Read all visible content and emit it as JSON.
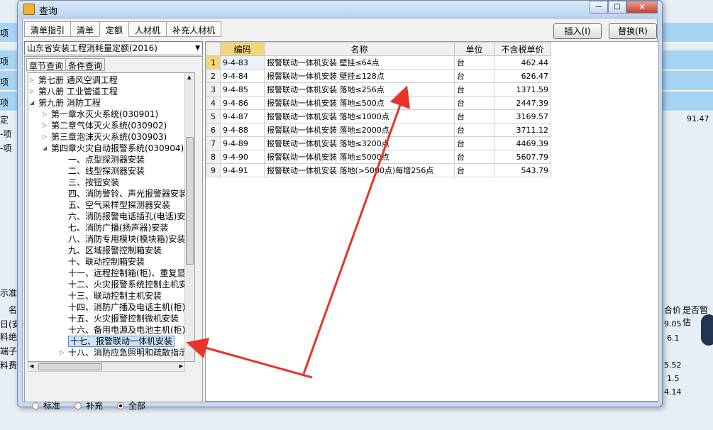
{
  "background": {
    "left_texts": [
      "项",
      "项",
      "项",
      "项",
      "定",
      "-项",
      "-项"
    ],
    "right_value": "91.47",
    "bottom_left": [
      "示准描",
      "名",
      "日(安",
      "料绝",
      "端子",
      "料费"
    ],
    "bottom_right_header": [
      "合价",
      "是否暂估"
    ],
    "bottom_right_values": [
      "9.05",
      "6.1",
      "5.52",
      "1.5",
      "4.14"
    ]
  },
  "dialog": {
    "title": "查询",
    "tabs": [
      "清单指引",
      "清单",
      "定额",
      "人材机",
      "补充人材机"
    ],
    "active_tab": 2,
    "insert_button": "插入(I)",
    "replace_button": "替换(R)",
    "library_select": "山东省安装工程消耗量定额(2016)",
    "subtabs": [
      "章节查询",
      "条件查询"
    ],
    "tree": [
      {
        "label": "第七册 通风空调工程",
        "level": 0,
        "exp": "right"
      },
      {
        "label": "第八册 工业管道工程",
        "level": 0,
        "exp": "right"
      },
      {
        "label": "第九册 消防工程",
        "level": 0,
        "exp": "down"
      },
      {
        "label": "第一章水灭火系统(030901)",
        "level": 1,
        "exp": "right"
      },
      {
        "label": "第二章气体灭火系统(030902)",
        "level": 1,
        "exp": "right"
      },
      {
        "label": "第三章泡沫灭火系统(030903)",
        "level": 1,
        "exp": "right"
      },
      {
        "label": "第四章火灾自动报警系统(030904)",
        "level": 1,
        "exp": "down"
      },
      {
        "label": "一、点型探测器安装",
        "level": 2
      },
      {
        "label": "二、线型探测器安装",
        "level": 2
      },
      {
        "label": "三、按钮安装",
        "level": 2
      },
      {
        "label": "四、消防警铃、声光报警器安装",
        "level": 2
      },
      {
        "label": "五、空气采样型探测器安装",
        "level": 2
      },
      {
        "label": "六、消防报警电话插孔(电话)安装",
        "level": 2
      },
      {
        "label": "七、消防广播(扬声器)安装",
        "level": 2
      },
      {
        "label": "八、消防专用模块(模块箱)安装",
        "level": 2
      },
      {
        "label": "九、区域报警控制箱安装",
        "level": 2
      },
      {
        "label": "十、联动控制箱安装",
        "level": 2
      },
      {
        "label": "十一、远程控制箱(柜)、重复显示器",
        "level": 2
      },
      {
        "label": "十二、火灾报警系统控制主机安装",
        "level": 2
      },
      {
        "label": "十三、联动控制主机安装",
        "level": 2
      },
      {
        "label": "十四、消防广播及电话主机(柜)安装",
        "level": 2
      },
      {
        "label": "十五、火灾报警控制微机安装",
        "level": 2
      },
      {
        "label": "十六、备用电源及电池主机(柜)安装",
        "level": 2
      },
      {
        "label": "十七、报警联动一体机安装",
        "level": 2,
        "selected": true
      },
      {
        "label": "十八、消防应急照明和疏散指示系统",
        "level": 2,
        "exp": "right"
      }
    ],
    "radios": [
      "标准",
      "补充",
      "全部"
    ],
    "radio_selected": 2,
    "grid_headers": [
      "",
      "编码",
      "名称",
      "单位",
      "不含税单价"
    ],
    "rows": [
      {
        "n": "1",
        "code": "9-4-83",
        "name": "报警联动一体机安装 壁挂≤64点",
        "unit": "台",
        "price": "462.44"
      },
      {
        "n": "2",
        "code": "9-4-84",
        "name": "报警联动一体机安装 壁挂≤128点",
        "unit": "台",
        "price": "626.47"
      },
      {
        "n": "3",
        "code": "9-4-85",
        "name": "报警联动一体机安装 落地≤256点",
        "unit": "台",
        "price": "1371.59"
      },
      {
        "n": "4",
        "code": "9-4-86",
        "name": "报警联动一体机安装 落地≤500点",
        "unit": "台",
        "price": "2447.39"
      },
      {
        "n": "5",
        "code": "9-4-87",
        "name": "报警联动一体机安装 落地≤1000点",
        "unit": "台",
        "price": "3169.57"
      },
      {
        "n": "6",
        "code": "9-4-88",
        "name": "报警联动一体机安装 落地≤2000点",
        "unit": "台",
        "price": "3711.12"
      },
      {
        "n": "7",
        "code": "9-4-89",
        "name": "报警联动一体机安装 落地≤3200点",
        "unit": "台",
        "price": "4469.39"
      },
      {
        "n": "8",
        "code": "9-4-90",
        "name": "报警联动一体机安装 落地≤5000点",
        "unit": "台",
        "price": "5607.79"
      },
      {
        "n": "9",
        "code": "9-4-91",
        "name": "报警联动一体机安装 落地(>5000点)每增256点",
        "unit": "台",
        "price": "543.79"
      }
    ]
  },
  "colors": {
    "accent": "#f3d57a",
    "arrow": "#e8332a"
  }
}
